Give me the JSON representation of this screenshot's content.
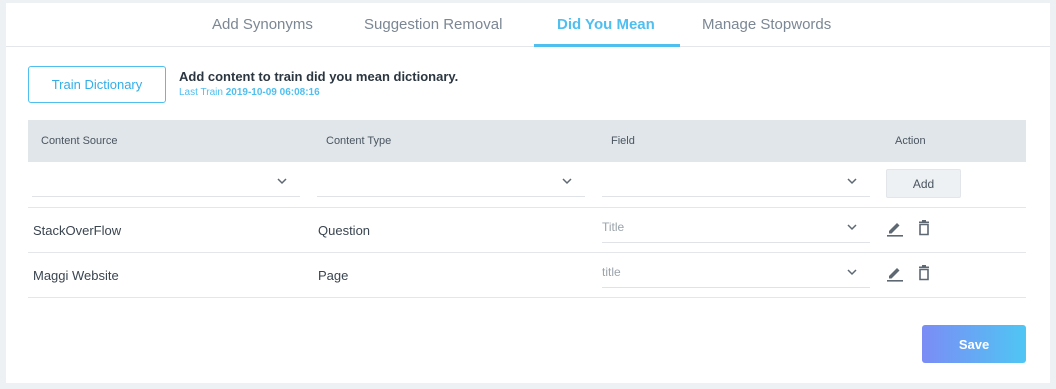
{
  "tabs": [
    {
      "label": "Add Synonyms",
      "active": false
    },
    {
      "label": "Suggestion Removal",
      "active": false
    },
    {
      "label": "Did You Mean",
      "active": true
    },
    {
      "label": "Manage Stopwords",
      "active": false
    }
  ],
  "train": {
    "button_label": "Train Dictionary",
    "description": "Add content to train did you mean dictionary.",
    "last_train_label": "Last Train",
    "last_train_date": "2019-10-09 06:08:16"
  },
  "table": {
    "columns": [
      "Content Source",
      "Content Type",
      "Field",
      "Action"
    ],
    "new_row": {
      "content_source": "",
      "content_type": "",
      "field": "",
      "add_label": "Add"
    },
    "rows": [
      {
        "content_source": "StackOverFlow",
        "content_type": "Question",
        "field": "Title"
      },
      {
        "content_source": "Maggi Website",
        "content_type": "Page",
        "field": "title"
      }
    ]
  },
  "icons": {
    "dropdown": "chevron-down-icon",
    "edit": "pencil-icon",
    "delete": "trash-icon"
  },
  "colors": {
    "accent": "#4fbff0",
    "save_gradient_start": "#7b8cf5",
    "save_gradient_end": "#4fc6f4",
    "table_header_bg": "#e1e6ea"
  },
  "save_label": "Save"
}
